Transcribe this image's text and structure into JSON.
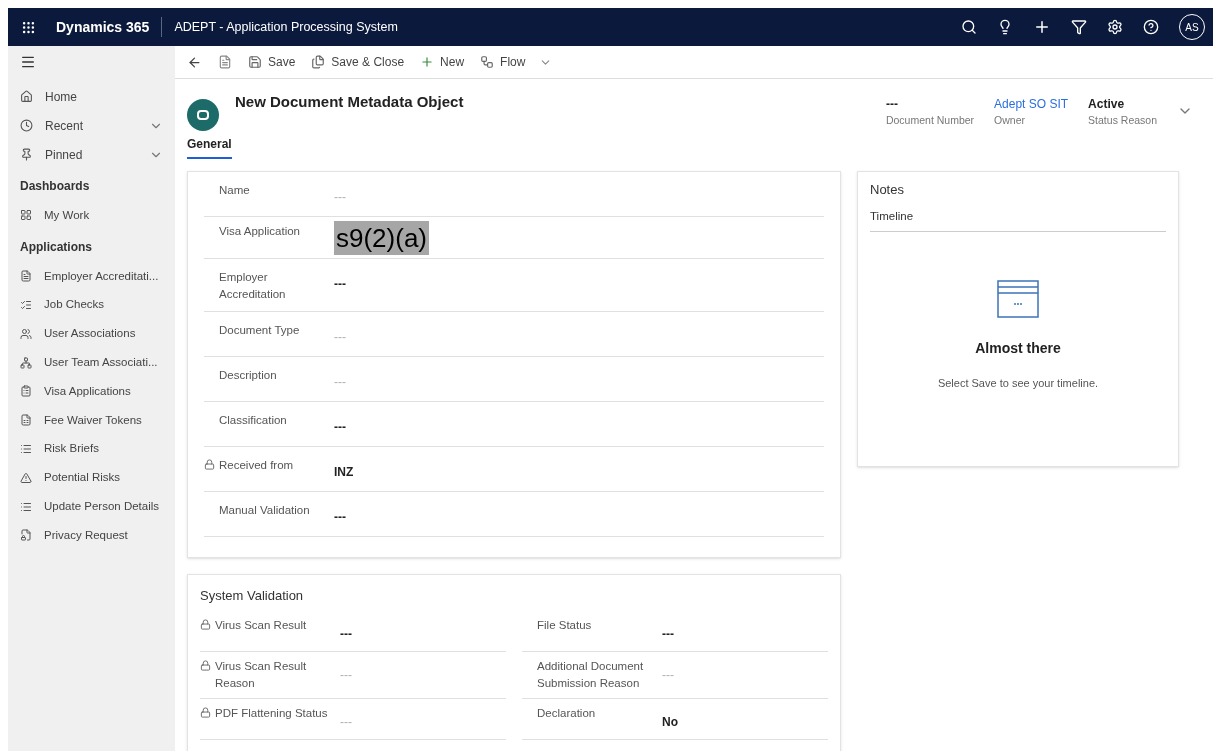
{
  "app_bar": {
    "product": "Dynamics 365",
    "app_name": "ADEPT - Application Processing System",
    "avatar": "AS"
  },
  "sidebar": {
    "top_items": [
      {
        "label": "Home",
        "expandable": false
      },
      {
        "label": "Recent",
        "expandable": true
      },
      {
        "label": "Pinned",
        "expandable": true
      }
    ],
    "groups": [
      {
        "title": "Dashboards",
        "items": [
          {
            "label": "My Work"
          }
        ]
      },
      {
        "title": "Applications",
        "items": [
          {
            "label": "Employer Accreditati..."
          },
          {
            "label": "Job Checks"
          },
          {
            "label": "User Associations"
          },
          {
            "label": "User Team Associati..."
          },
          {
            "label": "Visa Applications"
          },
          {
            "label": "Fee Waiver Tokens"
          },
          {
            "label": "Risk Briefs"
          },
          {
            "label": "Potential Risks"
          },
          {
            "label": "Update Person Details"
          },
          {
            "label": "Privacy Request"
          }
        ]
      }
    ]
  },
  "command_bar": {
    "save": "Save",
    "save_close": "Save & Close",
    "new": "New",
    "flow": "Flow"
  },
  "record": {
    "title": "New Document Metadata Object",
    "header_fields": [
      {
        "value": "---",
        "label": "Document Number",
        "kind": "text"
      },
      {
        "value": "Adept SO SIT",
        "label": "Owner",
        "kind": "link"
      },
      {
        "value": "Active",
        "label": "Status Reason",
        "kind": "text"
      }
    ]
  },
  "tabs": [
    {
      "label": "General",
      "selected": true
    }
  ],
  "general": {
    "fields": [
      {
        "label": "Name",
        "placeholder": "---",
        "locked": false,
        "kind": "text"
      },
      {
        "label": "Visa Application",
        "value": "s9(2)(a)",
        "locked": false,
        "kind": "redacted"
      },
      {
        "label": "Employer Accreditation",
        "value": "---",
        "locked": false,
        "kind": "text"
      },
      {
        "label": "Document Type",
        "placeholder": "---",
        "locked": false,
        "kind": "text"
      },
      {
        "label": "Description",
        "placeholder": "---",
        "locked": false,
        "kind": "text"
      },
      {
        "label": "Classification",
        "value": "---",
        "locked": false,
        "kind": "text"
      },
      {
        "label": "Received from",
        "value": "INZ",
        "locked": true,
        "kind": "text"
      },
      {
        "label": "Manual Validation",
        "value": "---",
        "locked": false,
        "kind": "text"
      }
    ]
  },
  "system_validation": {
    "title": "System Validation",
    "left": [
      {
        "label": "Virus Scan Result",
        "value": "---",
        "locked": true
      },
      {
        "label": "Virus Scan Result Reason",
        "placeholder": "---",
        "locked": true
      },
      {
        "label": "PDF Flattening Status",
        "placeholder": "---",
        "locked": true
      }
    ],
    "right": [
      {
        "label": "File Status",
        "value": "---",
        "locked": false
      },
      {
        "label": "Additional Document Submission Reason",
        "placeholder": "---",
        "locked": false
      },
      {
        "label": "Declaration",
        "value": "No",
        "locked": false
      }
    ]
  },
  "notes": {
    "title": "Notes",
    "tab": "Timeline",
    "empty_title": "Almost there",
    "empty_text": "Select Save to see your timeline."
  }
}
